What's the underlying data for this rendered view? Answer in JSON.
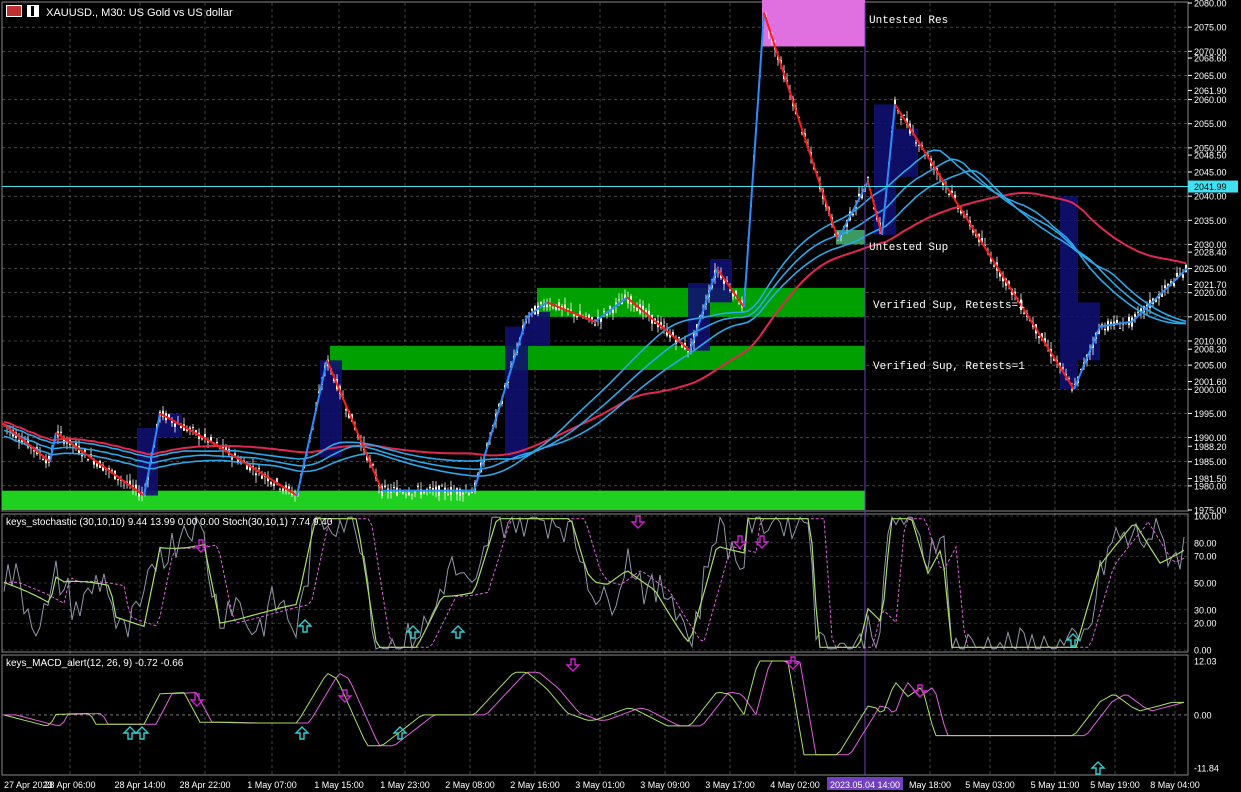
{
  "header": {
    "symbol": "XAUUSD.",
    "timeframe": "M30",
    "description": "US Gold vs US dollar"
  },
  "colors": {
    "background": "#000000",
    "grid": "#c8c8c8",
    "bull_candle": "#f5f0c0",
    "bear_candle": "#ffffff",
    "zigzag_up": "#2a8cff",
    "zigzag_down": "#ff1a1a",
    "ma_blue": "#2aa8e8",
    "ma_red": "#e02850",
    "supply_zone": "#e070e0",
    "demand_zone": "#00a000",
    "demand_zone_light": "#20d020",
    "box_zone": "#101070",
    "current_price_line": "#40e0f0",
    "stoch_main": "#a8e060",
    "stoch_signal": "#e060e0",
    "stoch_raw": "#9098a8",
    "macd_main": "#a8e060",
    "macd_signal": "#e060e0",
    "arrow_up": "#30d0d0",
    "arrow_down": "#d020d0",
    "vline": "#7040c0"
  },
  "chart_data": {
    "type": "candlestick",
    "y_ticks": [
      "2080.00",
      "2075.00",
      "2070.00",
      "2068.60",
      "2065.00",
      "2061.90",
      "2060.00",
      "2055.00",
      "2050.00",
      "2048.50",
      "2045.00",
      "2040.00",
      "2035.00",
      "2030.00",
      "2028.40",
      "2025.00",
      "2021.70",
      "2020.00",
      "2015.00",
      "2010.00",
      "2008.30",
      "2005.00",
      "2001.60",
      "2000.00",
      "1995.00",
      "1990.00",
      "1988.20",
      "1985.00",
      "1981.50",
      "1980.00",
      "1975.00"
    ],
    "current_price": "2041.99",
    "x_ticks": [
      "27 Apr 2023",
      "28 Apr 06:00",
      "28 Apr 14:00",
      "28 Apr 22:00",
      "1 May 07:00",
      "1 May 15:00",
      "1 May 23:00",
      "2 May 08:00",
      "2 May 16:00",
      "3 May 01:00",
      "3 May 09:00",
      "3 May 17:00",
      "4 May 02:00",
      "2023.05.04 14:00",
      "May 18:00",
      "5 May 03:00",
      "5 May 11:00",
      "5 May 19:00",
      "8 May 04:00"
    ],
    "zone_labels": [
      "Untested Res",
      "Untested Sup",
      "Verified Sup, Retests=1",
      "Verified Sup, Retests=1"
    ],
    "price_range": [
      1975,
      2080
    ],
    "zigzag": [
      {
        "t": 0,
        "price": 1993
      },
      {
        "t": 48,
        "price": 1985
      },
      {
        "t": 54,
        "price": 1991
      },
      {
        "t": 142,
        "price": 1978
      },
      {
        "t": 158,
        "price": 1995
      },
      {
        "t": 210,
        "price": 1989
      },
      {
        "t": 295,
        "price": 1978
      },
      {
        "t": 325,
        "price": 2006
      },
      {
        "t": 380,
        "price": 1979
      },
      {
        "t": 472,
        "price": 1979
      },
      {
        "t": 525,
        "price": 2015
      },
      {
        "t": 545,
        "price": 2018
      },
      {
        "t": 593,
        "price": 2014
      },
      {
        "t": 625,
        "price": 2019
      },
      {
        "t": 688,
        "price": 2008
      },
      {
        "t": 715,
        "price": 2025
      },
      {
        "t": 742,
        "price": 2017
      },
      {
        "t": 762,
        "price": 2078
      },
      {
        "t": 836,
        "price": 2031
      },
      {
        "t": 866,
        "price": 2043
      },
      {
        "t": 880,
        "price": 2032
      },
      {
        "t": 893,
        "price": 2059
      },
      {
        "t": 1072,
        "price": 2000
      },
      {
        "t": 1098,
        "price": 2013
      },
      {
        "t": 1130,
        "price": 2014
      },
      {
        "t": 1185,
        "price": 2025
      }
    ],
    "zones": [
      {
        "label": "Untested Res",
        "from": 2071,
        "to": 2081,
        "kind": "supply"
      },
      {
        "label": "Untested Sup",
        "from": 2030,
        "to": 2033,
        "kind": "demand"
      },
      {
        "label": "Verified Sup, Retests=1",
        "from": 2015,
        "to": 2021,
        "kind": "demand"
      },
      {
        "label": "Verified Sup, Retests=1",
        "from": 2004,
        "to": 2009,
        "kind": "demand"
      },
      {
        "label": "",
        "from": 1975,
        "to": 1979,
        "kind": "demand_light"
      }
    ],
    "indicators": [
      {
        "name": "keys_stochastic (30,10,10)",
        "values": [
          "9.44",
          "13.99",
          "0.00",
          "0.00"
        ],
        "secondary": {
          "name": "Stoch(30,10,1)",
          "values": [
            "7.74",
            "9.40"
          ]
        },
        "y_ticks": [
          "100.00",
          "80.00",
          "70.00",
          "50.00",
          "30.00",
          "20.00",
          "0.00"
        ],
        "range": [
          0,
          100
        ]
      },
      {
        "name": "keys_MACD_alert(12, 26, 9)",
        "values": [
          "-0.72",
          "-0.66"
        ],
        "y_ticks": [
          "12.03",
          "0.00",
          "-11.84"
        ],
        "range": [
          -11.84,
          12.03
        ]
      }
    ]
  }
}
